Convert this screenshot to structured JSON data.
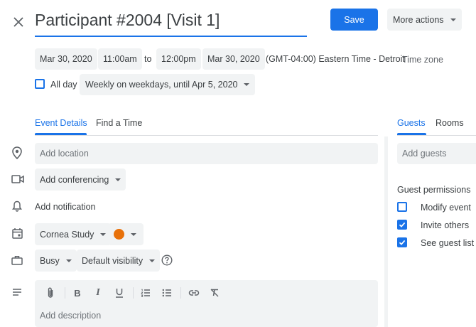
{
  "title": "Participant #2004 [Visit 1]",
  "header": {
    "save_label": "Save",
    "more_actions_label": "More actions"
  },
  "datetime": {
    "start_date": "Mar 30, 2020",
    "start_time": "11:00am",
    "to_label": "to",
    "end_time": "12:00pm",
    "end_date": "Mar 30, 2020",
    "timezone_value": "(GMT-04:00) Eastern Time - Detroit",
    "timezone_link": "Time zone",
    "all_day_label": "All day",
    "recurrence": "Weekly on weekdays, until Apr 5, 2020"
  },
  "tabs": {
    "event_details": "Event Details",
    "find_time": "Find a Time"
  },
  "details": {
    "location_placeholder": "Add location",
    "conferencing_label": "Add conferencing",
    "notification_label": "Add notification",
    "calendar_name": "Cornea Study",
    "event_color": "#e8710a",
    "availability": "Busy",
    "visibility": "Default visibility",
    "description_placeholder": "Add description"
  },
  "guests_panel": {
    "tab_guests": "Guests",
    "tab_rooms": "Rooms",
    "add_guests_placeholder": "Add guests",
    "permissions_title": "Guest permissions",
    "permissions": [
      {
        "label": "Modify event",
        "checked": false
      },
      {
        "label": "Invite others",
        "checked": true
      },
      {
        "label": "See guest list",
        "checked": true
      }
    ]
  },
  "colors": {
    "accent": "#1a73e8",
    "chip_bg": "#f1f3f4",
    "text": "#3c4043",
    "icon": "#5f6368"
  }
}
